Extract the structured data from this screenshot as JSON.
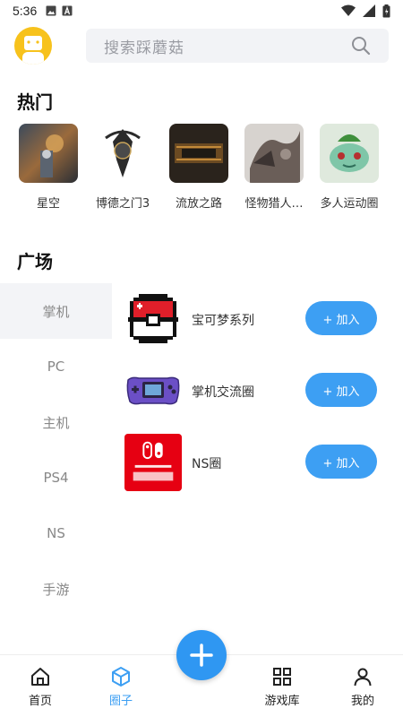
{
  "status_bar": {
    "time": "5:36"
  },
  "search": {
    "placeholder": "搜索踩蘑菇"
  },
  "hot": {
    "title": "热门",
    "items": [
      {
        "label": "星空",
        "icon": "starfield-thumb"
      },
      {
        "label": "博德之门3",
        "icon": "baldurs-gate-thumb"
      },
      {
        "label": "流放之路",
        "icon": "path-of-exile-thumb"
      },
      {
        "label": "怪物猎人…",
        "icon": "monster-hunter-thumb"
      },
      {
        "label": "多人运动圈",
        "icon": "bulbasaur-thumb"
      }
    ]
  },
  "plaza": {
    "title": "广场",
    "categories": [
      "掌机",
      "PC",
      "主机",
      "PS4",
      "NS",
      "手游"
    ],
    "active_category": "掌机",
    "circles": [
      {
        "name": "宝可梦系列",
        "join_label": "+ 加入",
        "icon": "pokeball-icon"
      },
      {
        "name": "掌机交流圈",
        "join_label": "+ 加入",
        "icon": "gameboy-advance-icon"
      },
      {
        "name": "NS圈",
        "join_label": "+ 加入",
        "icon": "nintendo-switch-icon"
      }
    ]
  },
  "nav": {
    "items": [
      {
        "label": "首页",
        "icon": "home-icon"
      },
      {
        "label": "圈子",
        "icon": "cube-icon",
        "active": true
      },
      {
        "label": "游戏库",
        "icon": "grid-icon"
      },
      {
        "label": "我的",
        "icon": "user-icon"
      }
    ]
  },
  "colors": {
    "accent": "#3d9ff3",
    "fab": "#2f97f2",
    "avatar_bg": "#f7c21c"
  }
}
